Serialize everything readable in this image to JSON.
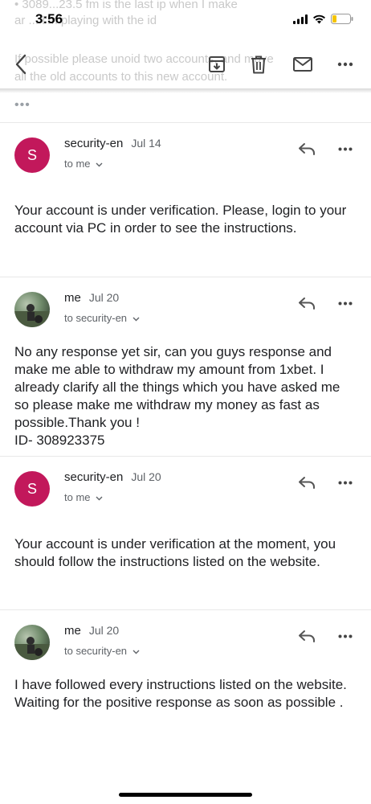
{
  "status_bar": {
    "time": "3:56",
    "icons": [
      "signal-icon",
      "wifi-icon",
      "battery-icon"
    ]
  },
  "background_text": {
    "line1": "• 3089...23.5 fm is the last ip when I make",
    "line2": "ar ... I'm playing with the id",
    "line3": "If possible please unoid two accounts, and move",
    "line4": "all the old accounts to this new account."
  },
  "toolbar": {
    "back_icon": "back-chevron-icon",
    "archive_icon": "archive-icon",
    "delete_icon": "trash-icon",
    "mark_unread_icon": "mail-icon",
    "more_icon": "more-horizontal-icon"
  },
  "thread": {
    "collapsed_indicator": "•••",
    "messages": [
      {
        "sender": "security-en",
        "date": "Jul 14",
        "recipient": "to me",
        "avatar_letter": "S",
        "body": "Your account is under verification. Please, login to your account via PC in order to see the instructions."
      },
      {
        "sender": "me",
        "date": "Jul 20",
        "recipient": "to security-en",
        "avatar_letter": "",
        "body": "No any response yet sir, can you guys response and make me able to withdraw my amount from 1xbet. I already clarify all the things which you have asked me so please make me withdraw my money as fast as possible.Thank you !\nID- 308923375"
      },
      {
        "sender": "security-en",
        "date": "Jul 20",
        "recipient": "to me",
        "avatar_letter": "S",
        "body": "Your account is under verification at the moment, you should follow the instructions listed on the website."
      },
      {
        "sender": "me",
        "date": "Jul 20",
        "recipient": "to security-en",
        "avatar_letter": "",
        "body": "I have followed every instructions listed on the website. Waiting for the positive response as soon as possible ."
      }
    ]
  },
  "colors": {
    "avatar_s": "#c2185b",
    "text_primary": "#202124",
    "text_secondary": "#5f6368"
  }
}
